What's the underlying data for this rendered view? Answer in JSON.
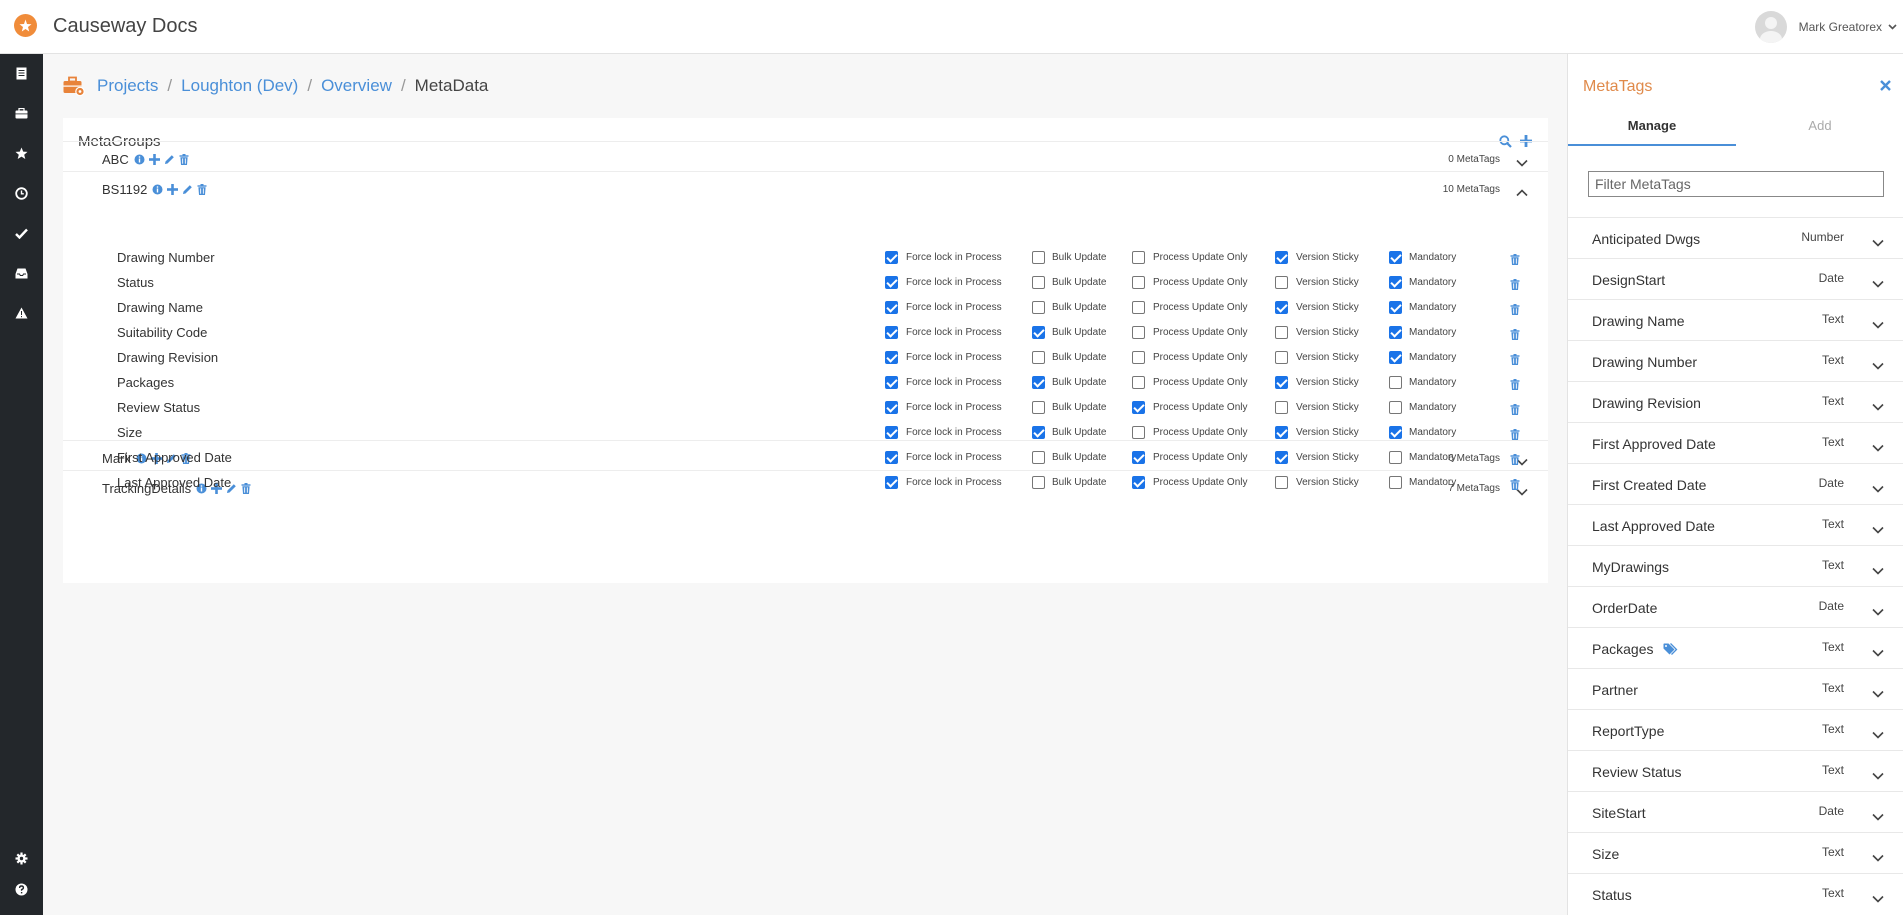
{
  "app": {
    "title": "Causeway Docs"
  },
  "user": {
    "name": "Mark Greatorex"
  },
  "nav_icons": [
    "document-icon",
    "briefcase-icon",
    "star-icon",
    "clock-icon",
    "check-icon",
    "inbox-icon",
    "warning-icon"
  ],
  "nav_bottom_icons": [
    "gear-icon",
    "help-icon"
  ],
  "breadcrumb": {
    "items": [
      "Projects",
      "Loughton (Dev)",
      "Overview"
    ],
    "current": "MetaData",
    "separator": "/"
  },
  "metagroups": {
    "title": "MetaGroups",
    "groups": [
      {
        "name": "ABC",
        "count": "0 MetaTags",
        "expanded": false
      },
      {
        "name": "BS1192",
        "count": "10 MetaTags",
        "expanded": true
      },
      {
        "name": "Mark",
        "count": "6 MetaTags",
        "expanded": false
      },
      {
        "name": "TrackingDetails",
        "count": "7 MetaTags",
        "expanded": false
      }
    ],
    "option_labels": {
      "force_lock": "Force lock in Process",
      "bulk_update": "Bulk Update",
      "process_update_only": "Process Update Only",
      "version_sticky": "Version Sticky",
      "mandatory": "Mandatory"
    },
    "tags": [
      {
        "name": "Drawing Number",
        "force_lock": true,
        "bulk_update": false,
        "process_update_only": false,
        "version_sticky": true,
        "mandatory": true
      },
      {
        "name": "Status",
        "force_lock": true,
        "bulk_update": false,
        "process_update_only": false,
        "version_sticky": false,
        "mandatory": true
      },
      {
        "name": "Drawing Name",
        "force_lock": true,
        "bulk_update": false,
        "process_update_only": false,
        "version_sticky": true,
        "mandatory": true
      },
      {
        "name": "Suitability Code",
        "force_lock": true,
        "bulk_update": true,
        "process_update_only": false,
        "version_sticky": false,
        "mandatory": true
      },
      {
        "name": "Drawing Revision",
        "force_lock": true,
        "bulk_update": false,
        "process_update_only": false,
        "version_sticky": false,
        "mandatory": true
      },
      {
        "name": "Packages",
        "force_lock": true,
        "bulk_update": true,
        "process_update_only": false,
        "version_sticky": true,
        "mandatory": false
      },
      {
        "name": "Review Status",
        "force_lock": true,
        "bulk_update": false,
        "process_update_only": true,
        "version_sticky": false,
        "mandatory": false
      },
      {
        "name": "Size",
        "force_lock": true,
        "bulk_update": true,
        "process_update_only": false,
        "version_sticky": true,
        "mandatory": true
      },
      {
        "name": "First Approved Date",
        "force_lock": true,
        "bulk_update": false,
        "process_update_only": true,
        "version_sticky": true,
        "mandatory": false
      },
      {
        "name": "Last Approved Date",
        "force_lock": true,
        "bulk_update": false,
        "process_update_only": true,
        "version_sticky": false,
        "mandatory": false
      }
    ]
  },
  "metatags_panel": {
    "title": "MetaTags",
    "tabs": {
      "manage": "Manage",
      "add": "Add"
    },
    "filter_placeholder": "Filter MetaTags",
    "filter_value": "",
    "items": [
      {
        "name": "Anticipated Dwgs",
        "type": "Number"
      },
      {
        "name": "DesignStart",
        "type": "Date"
      },
      {
        "name": "Drawing Name",
        "type": "Text"
      },
      {
        "name": "Drawing Number",
        "type": "Text"
      },
      {
        "name": "Drawing Revision",
        "type": "Text"
      },
      {
        "name": "First Approved Date",
        "type": "Text"
      },
      {
        "name": "First Created Date",
        "type": "Date"
      },
      {
        "name": "Last Approved Date",
        "type": "Text"
      },
      {
        "name": "MyDrawings",
        "type": "Text"
      },
      {
        "name": "OrderDate",
        "type": "Date"
      },
      {
        "name": "Packages",
        "type": "Text",
        "tag_icon": true
      },
      {
        "name": "Partner",
        "type": "Text"
      },
      {
        "name": "ReportType",
        "type": "Text"
      },
      {
        "name": "Review Status",
        "type": "Text"
      },
      {
        "name": "SiteStart",
        "type": "Date"
      },
      {
        "name": "Size",
        "type": "Text"
      },
      {
        "name": "Status",
        "type": "Text"
      }
    ]
  },
  "colors": {
    "accent_blue": "#4a8fd8",
    "brand_orange": "#f08c3a",
    "nav_dark": "#23272b",
    "checkbox_blue": "#1a73e8"
  }
}
